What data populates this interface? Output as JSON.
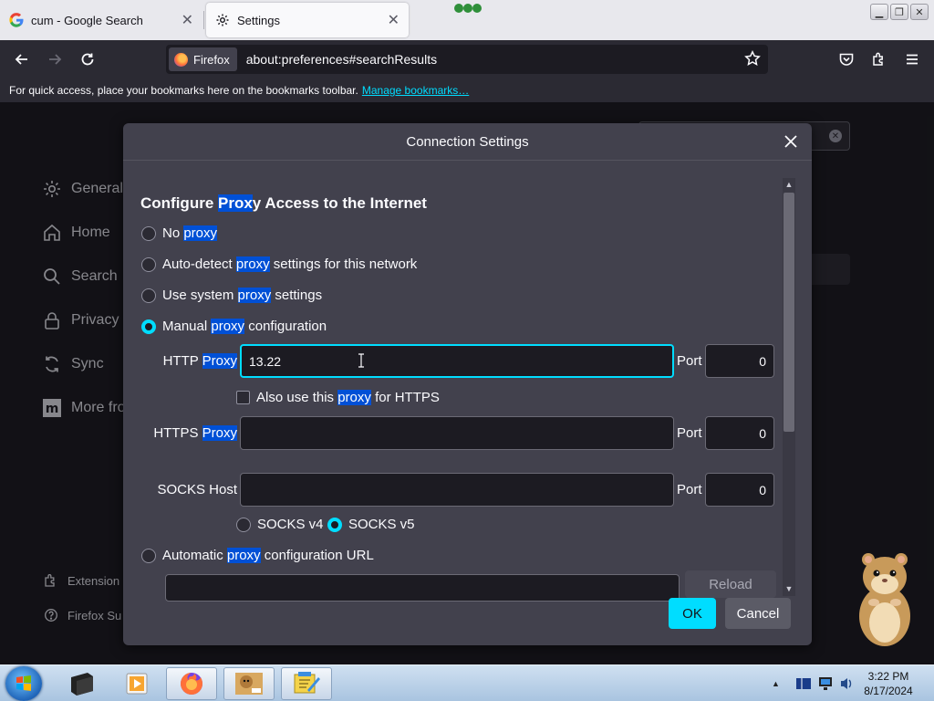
{
  "tabs": [
    {
      "title": "cum - Google Search",
      "favicon": "google-g-icon",
      "active": false
    },
    {
      "title": "Settings",
      "favicon": "gear-icon",
      "active": true
    }
  ],
  "nav": {
    "identity_label": "Firefox",
    "url": "about:preferences#searchResults"
  },
  "bookmarks_bar": {
    "text": "For quick access, place your bookmarks here on the bookmarks toolbar.",
    "link": "Manage bookmarks…"
  },
  "sidebar": {
    "items": [
      {
        "label": "General",
        "icon": "gear-icon"
      },
      {
        "label": "Home",
        "icon": "home-icon"
      },
      {
        "label": "Search",
        "icon": "search-icon"
      },
      {
        "label": "Privacy &",
        "icon": "lock-icon"
      },
      {
        "label": "Sync",
        "icon": "sync-icon"
      },
      {
        "label": "More fro",
        "icon": "mozilla-m-icon"
      }
    ],
    "footer": [
      {
        "label": "Extension",
        "icon": "puzzle-icon"
      },
      {
        "label": "Firefox Su",
        "icon": "help-icon"
      }
    ]
  },
  "dialog": {
    "title": "Connection Settings",
    "heading": {
      "pre": "Configure ",
      "hl": "Prox",
      "post": "y Access to the Internet"
    },
    "options": {
      "no_proxy": {
        "pre": "No ",
        "hl": "proxy",
        "post": "",
        "checked": false
      },
      "auto_detect": {
        "pre": "Auto-detect ",
        "hl": "proxy",
        "post": " settings for this network",
        "checked": false
      },
      "system": {
        "pre": "Use system ",
        "hl": "proxy",
        "post": " settings",
        "checked": false
      },
      "manual": {
        "pre": "Manual ",
        "hl": "proxy",
        "post": " configuration",
        "checked": true
      },
      "auto_url": {
        "pre": "Automatic ",
        "hl": "proxy",
        "post": " configuration URL",
        "checked": false
      }
    },
    "http": {
      "label_pre": "HTTP ",
      "label_hl": "Proxy",
      "value": "13.22",
      "port_label": "Port",
      "port": "0"
    },
    "also_https": {
      "pre": "Also use this ",
      "hl": "proxy",
      "post": " for HTTPS",
      "checked": false
    },
    "https": {
      "label_pre": "HTTPS ",
      "label_hl": "Proxy",
      "value": "",
      "port_label": "Port",
      "port": "0"
    },
    "socks": {
      "label": "SOCKS Host",
      "value": "",
      "port_label": "Port",
      "port": "0"
    },
    "socks_v4": {
      "label": "SOCKS v4",
      "checked": false
    },
    "socks_v5": {
      "label": "SOCKS v5",
      "checked": true
    },
    "reload_label": "Reload",
    "ok_label": "OK",
    "cancel_label": "Cancel"
  },
  "taskbar": {
    "time": "3:22 PM",
    "date": "8/17/2024"
  },
  "colors": {
    "accent": "#00ddff",
    "highlight": "#0050d6",
    "dialog_bg": "#42414d",
    "page_bg": "#1c1b22"
  }
}
